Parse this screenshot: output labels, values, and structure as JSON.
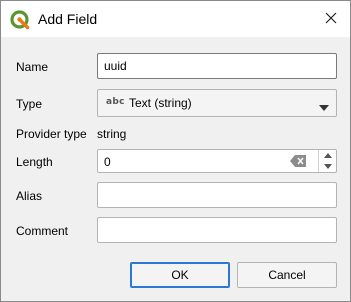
{
  "window": {
    "title": "Add Field",
    "app_icon": "qgis-logo-icon",
    "close_icon": "close-icon",
    "accent_color": "#2b78d6",
    "icon_green": "#589632",
    "icon_yellow": "#ee7913"
  },
  "form": {
    "name_label": "Name",
    "name_value": "uuid",
    "type_label": "Type",
    "type_icon_text": "abc",
    "type_value": "Text (string)",
    "provider_type_label": "Provider type",
    "provider_type_value": "string",
    "length_label": "Length",
    "length_value": "0",
    "alias_label": "Alias",
    "alias_value": "",
    "comment_label": "Comment",
    "comment_value": ""
  },
  "buttons": {
    "ok_label": "OK",
    "cancel_label": "Cancel"
  }
}
